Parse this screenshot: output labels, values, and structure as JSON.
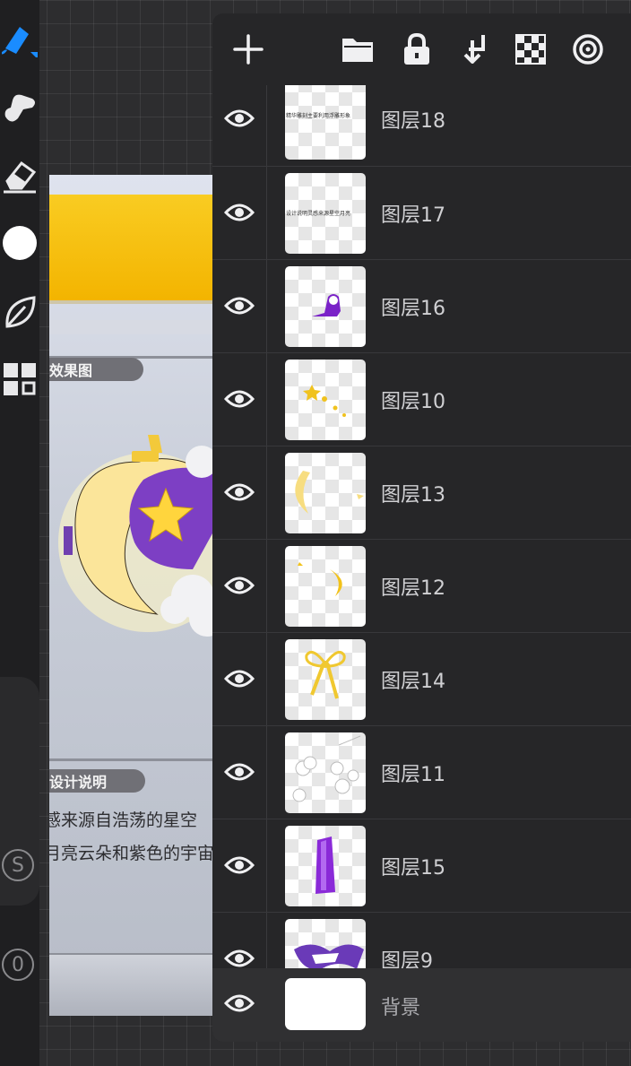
{
  "toolbar": {
    "tools": [
      {
        "name": "brush-icon"
      },
      {
        "name": "smudge-icon"
      },
      {
        "name": "eraser-icon"
      },
      {
        "name": "color-swatch-icon"
      },
      {
        "name": "leaf-icon"
      },
      {
        "name": "gallery-icon"
      }
    ],
    "size_button": "S",
    "opacity_button": "0",
    "accent_color": "#1a8cff"
  },
  "canvas": {
    "section1_tag": "效果图",
    "section2_tag": "设计说明",
    "desc_line1": "感来源自浩荡的星空",
    "desc_line2": "月亮云朵和紫色的宇宙镜"
  },
  "layers_panel": {
    "header_icons": [
      "add-layer-icon",
      "folder-icon",
      "lock-icon",
      "import-icon",
      "alpha-checker-icon",
      "spiral-icon"
    ],
    "layers": [
      {
        "name": "图层18",
        "visible": true,
        "thumb": "text-18"
      },
      {
        "name": "图层17",
        "visible": true,
        "thumb": "text-17"
      },
      {
        "name": "图层16",
        "visible": true,
        "thumb": "purple-mount"
      },
      {
        "name": "图层10",
        "visible": true,
        "thumb": "stars"
      },
      {
        "name": "图层13",
        "visible": true,
        "thumb": "moon-big"
      },
      {
        "name": "图层12",
        "visible": true,
        "thumb": "moon-small"
      },
      {
        "name": "图层14",
        "visible": true,
        "thumb": "ribbon"
      },
      {
        "name": "图层11",
        "visible": true,
        "thumb": "clouds"
      },
      {
        "name": "图层15",
        "visible": true,
        "thumb": "purple-bar"
      },
      {
        "name": "图层9",
        "visible": true,
        "thumb": "purple-splash"
      }
    ],
    "background_layer": {
      "name": "背景",
      "visible": true
    },
    "thumb_texts": {
      "text_18": "精华雕刻主要利用浮雕形象",
      "text_17": "设计说明灵感来源星空月亮"
    }
  }
}
